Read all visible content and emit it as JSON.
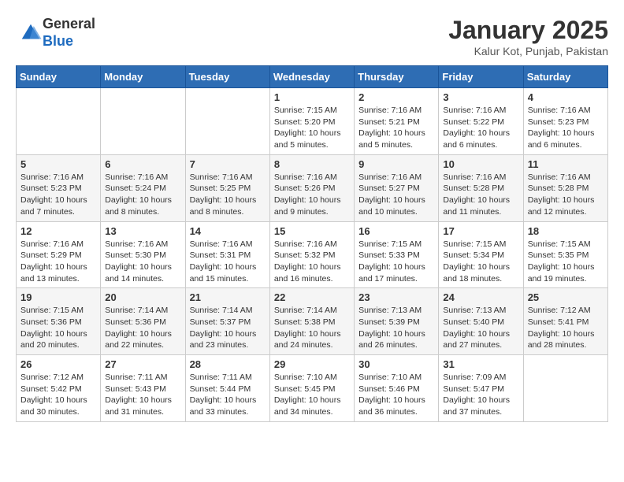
{
  "header": {
    "logo": {
      "line1": "General",
      "line2": "Blue"
    },
    "title": "January 2025",
    "subtitle": "Kalur Kot, Punjab, Pakistan"
  },
  "weekdays": [
    "Sunday",
    "Monday",
    "Tuesday",
    "Wednesday",
    "Thursday",
    "Friday",
    "Saturday"
  ],
  "weeks": [
    [
      {
        "day": "",
        "sunrise": "",
        "sunset": "",
        "daylight": ""
      },
      {
        "day": "",
        "sunrise": "",
        "sunset": "",
        "daylight": ""
      },
      {
        "day": "",
        "sunrise": "",
        "sunset": "",
        "daylight": ""
      },
      {
        "day": "1",
        "sunrise": "Sunrise: 7:15 AM",
        "sunset": "Sunset: 5:20 PM",
        "daylight": "Daylight: 10 hours and 5 minutes."
      },
      {
        "day": "2",
        "sunrise": "Sunrise: 7:16 AM",
        "sunset": "Sunset: 5:21 PM",
        "daylight": "Daylight: 10 hours and 5 minutes."
      },
      {
        "day": "3",
        "sunrise": "Sunrise: 7:16 AM",
        "sunset": "Sunset: 5:22 PM",
        "daylight": "Daylight: 10 hours and 6 minutes."
      },
      {
        "day": "4",
        "sunrise": "Sunrise: 7:16 AM",
        "sunset": "Sunset: 5:23 PM",
        "daylight": "Daylight: 10 hours and 6 minutes."
      }
    ],
    [
      {
        "day": "5",
        "sunrise": "Sunrise: 7:16 AM",
        "sunset": "Sunset: 5:23 PM",
        "daylight": "Daylight: 10 hours and 7 minutes."
      },
      {
        "day": "6",
        "sunrise": "Sunrise: 7:16 AM",
        "sunset": "Sunset: 5:24 PM",
        "daylight": "Daylight: 10 hours and 8 minutes."
      },
      {
        "day": "7",
        "sunrise": "Sunrise: 7:16 AM",
        "sunset": "Sunset: 5:25 PM",
        "daylight": "Daylight: 10 hours and 8 minutes."
      },
      {
        "day": "8",
        "sunrise": "Sunrise: 7:16 AM",
        "sunset": "Sunset: 5:26 PM",
        "daylight": "Daylight: 10 hours and 9 minutes."
      },
      {
        "day": "9",
        "sunrise": "Sunrise: 7:16 AM",
        "sunset": "Sunset: 5:27 PM",
        "daylight": "Daylight: 10 hours and 10 minutes."
      },
      {
        "day": "10",
        "sunrise": "Sunrise: 7:16 AM",
        "sunset": "Sunset: 5:28 PM",
        "daylight": "Daylight: 10 hours and 11 minutes."
      },
      {
        "day": "11",
        "sunrise": "Sunrise: 7:16 AM",
        "sunset": "Sunset: 5:28 PM",
        "daylight": "Daylight: 10 hours and 12 minutes."
      }
    ],
    [
      {
        "day": "12",
        "sunrise": "Sunrise: 7:16 AM",
        "sunset": "Sunset: 5:29 PM",
        "daylight": "Daylight: 10 hours and 13 minutes."
      },
      {
        "day": "13",
        "sunrise": "Sunrise: 7:16 AM",
        "sunset": "Sunset: 5:30 PM",
        "daylight": "Daylight: 10 hours and 14 minutes."
      },
      {
        "day": "14",
        "sunrise": "Sunrise: 7:16 AM",
        "sunset": "Sunset: 5:31 PM",
        "daylight": "Daylight: 10 hours and 15 minutes."
      },
      {
        "day": "15",
        "sunrise": "Sunrise: 7:16 AM",
        "sunset": "Sunset: 5:32 PM",
        "daylight": "Daylight: 10 hours and 16 minutes."
      },
      {
        "day": "16",
        "sunrise": "Sunrise: 7:15 AM",
        "sunset": "Sunset: 5:33 PM",
        "daylight": "Daylight: 10 hours and 17 minutes."
      },
      {
        "day": "17",
        "sunrise": "Sunrise: 7:15 AM",
        "sunset": "Sunset: 5:34 PM",
        "daylight": "Daylight: 10 hours and 18 minutes."
      },
      {
        "day": "18",
        "sunrise": "Sunrise: 7:15 AM",
        "sunset": "Sunset: 5:35 PM",
        "daylight": "Daylight: 10 hours and 19 minutes."
      }
    ],
    [
      {
        "day": "19",
        "sunrise": "Sunrise: 7:15 AM",
        "sunset": "Sunset: 5:36 PM",
        "daylight": "Daylight: 10 hours and 20 minutes."
      },
      {
        "day": "20",
        "sunrise": "Sunrise: 7:14 AM",
        "sunset": "Sunset: 5:36 PM",
        "daylight": "Daylight: 10 hours and 22 minutes."
      },
      {
        "day": "21",
        "sunrise": "Sunrise: 7:14 AM",
        "sunset": "Sunset: 5:37 PM",
        "daylight": "Daylight: 10 hours and 23 minutes."
      },
      {
        "day": "22",
        "sunrise": "Sunrise: 7:14 AM",
        "sunset": "Sunset: 5:38 PM",
        "daylight": "Daylight: 10 hours and 24 minutes."
      },
      {
        "day": "23",
        "sunrise": "Sunrise: 7:13 AM",
        "sunset": "Sunset: 5:39 PM",
        "daylight": "Daylight: 10 hours and 26 minutes."
      },
      {
        "day": "24",
        "sunrise": "Sunrise: 7:13 AM",
        "sunset": "Sunset: 5:40 PM",
        "daylight": "Daylight: 10 hours and 27 minutes."
      },
      {
        "day": "25",
        "sunrise": "Sunrise: 7:12 AM",
        "sunset": "Sunset: 5:41 PM",
        "daylight": "Daylight: 10 hours and 28 minutes."
      }
    ],
    [
      {
        "day": "26",
        "sunrise": "Sunrise: 7:12 AM",
        "sunset": "Sunset: 5:42 PM",
        "daylight": "Daylight: 10 hours and 30 minutes."
      },
      {
        "day": "27",
        "sunrise": "Sunrise: 7:11 AM",
        "sunset": "Sunset: 5:43 PM",
        "daylight": "Daylight: 10 hours and 31 minutes."
      },
      {
        "day": "28",
        "sunrise": "Sunrise: 7:11 AM",
        "sunset": "Sunset: 5:44 PM",
        "daylight": "Daylight: 10 hours and 33 minutes."
      },
      {
        "day": "29",
        "sunrise": "Sunrise: 7:10 AM",
        "sunset": "Sunset: 5:45 PM",
        "daylight": "Daylight: 10 hours and 34 minutes."
      },
      {
        "day": "30",
        "sunrise": "Sunrise: 7:10 AM",
        "sunset": "Sunset: 5:46 PM",
        "daylight": "Daylight: 10 hours and 36 minutes."
      },
      {
        "day": "31",
        "sunrise": "Sunrise: 7:09 AM",
        "sunset": "Sunset: 5:47 PM",
        "daylight": "Daylight: 10 hours and 37 minutes."
      },
      {
        "day": "",
        "sunrise": "",
        "sunset": "",
        "daylight": ""
      }
    ]
  ]
}
